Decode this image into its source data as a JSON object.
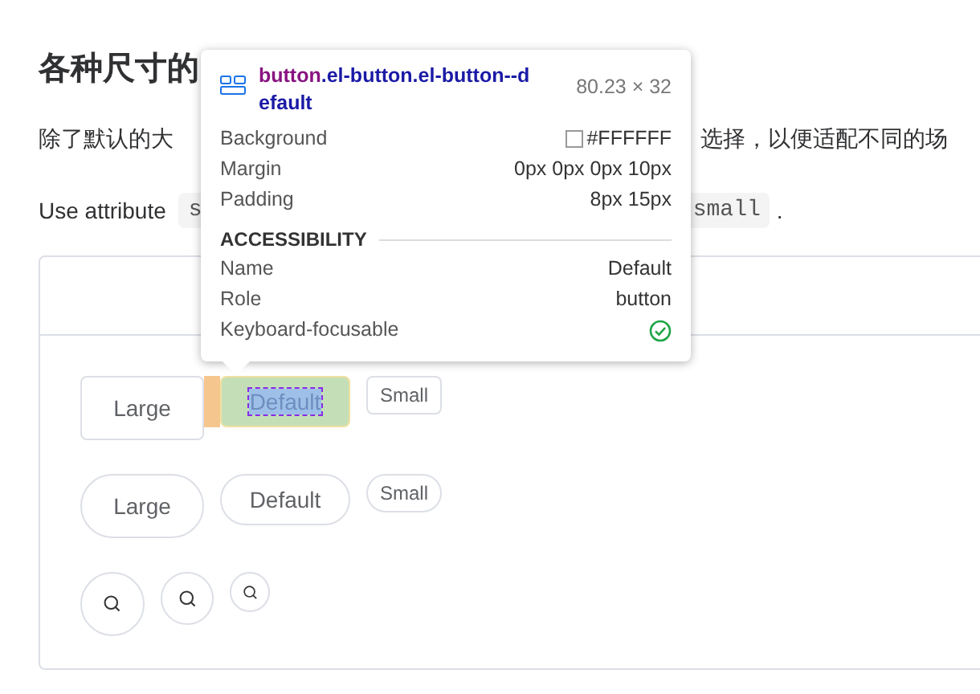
{
  "heading": "各种尺寸的",
  "intro": {
    "left": "除了默认的大",
    "right": "选择，以便适配不同的场"
  },
  "usage": {
    "text": "Use attribute",
    "code_left": "s",
    "code_right": "small",
    "end": "."
  },
  "button_rows": [
    {
      "kind": "plain",
      "buttons": [
        {
          "label": "Large",
          "highlighted": false
        },
        {
          "label": "Default",
          "highlighted": true
        },
        {
          "label": "Small",
          "highlighted": false
        }
      ]
    },
    {
      "kind": "round",
      "buttons": [
        {
          "label": "Large",
          "highlighted": false
        },
        {
          "label": "Default",
          "highlighted": false
        },
        {
          "label": "Small",
          "highlighted": false
        }
      ]
    },
    {
      "kind": "circle",
      "buttons": [
        {
          "highlighted": false
        },
        {
          "highlighted": false
        },
        {
          "highlighted": false
        }
      ]
    }
  ],
  "inspector": {
    "tag": "button",
    "classes": ".el-button.el-button--default",
    "dimensions": "80.23 × 32",
    "properties": [
      {
        "kind": "color",
        "name": "Background",
        "value": "#FFFFFF"
      },
      {
        "kind": "text",
        "name": "Margin",
        "value": "0px 0px 0px 10px"
      },
      {
        "kind": "text",
        "name": "Padding",
        "value": "8px 15px"
      }
    ],
    "section": "ACCESSIBILITY",
    "accessibility": [
      {
        "kind": "text",
        "name": "Name",
        "value": "Default"
      },
      {
        "kind": "text",
        "name": "Role",
        "value": "button"
      },
      {
        "kind": "check",
        "name": "Keyboard-focusable",
        "checked": true
      }
    ]
  }
}
